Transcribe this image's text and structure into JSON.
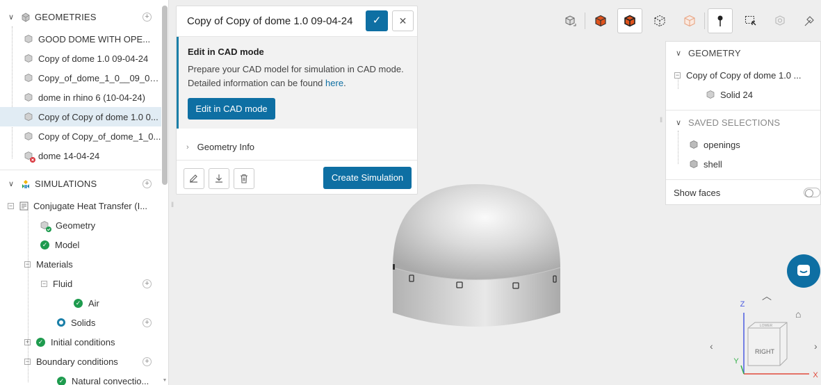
{
  "left_panel": {
    "geometries_header": "GEOMETRIES",
    "geometries": [
      {
        "label": "GOOD DOME WITH OPE..."
      },
      {
        "label": "Copy of dome 1.0 09-04-24"
      },
      {
        "label": "Copy_of_dome_1_0__09_04..."
      },
      {
        "label": "dome in rhino 6 (10-04-24)"
      },
      {
        "label": "Copy of Copy of dome 1.0 0..."
      },
      {
        "label": "Copy of Copy_of_dome_1_0..."
      },
      {
        "label": "dome 14-04-24"
      }
    ],
    "simulations_header": "SIMULATIONS",
    "simulation": {
      "label": "Conjugate Heat Transfer (I...",
      "items": {
        "geometry": "Geometry",
        "model": "Model",
        "materials": "Materials",
        "fluid": "Fluid",
        "air": "Air",
        "solids": "Solids",
        "initial_conditions": "Initial conditions",
        "boundary_conditions": "Boundary conditions",
        "natural_convection": "Natural convectio..."
      }
    }
  },
  "geo_card": {
    "title": "Copy of Copy of dome 1.0  09-04-24",
    "cad_title": "Edit in CAD mode",
    "cad_desc_1": "Prepare your CAD model for simulation in CAD mode.",
    "cad_desc_2": "Detailed information can be found",
    "cad_link": "here",
    "cad_desc_end": ".",
    "cad_button": "Edit in CAD mode",
    "geometry_info": "Geometry Info",
    "create_button": "Create Simulation"
  },
  "right_panel": {
    "geometry_header": "GEOMETRY",
    "geometry_item": "Copy of Copy of dome 1.0 ...",
    "solid_item": "Solid 24",
    "saved_header": "SAVED SELECTIONS",
    "selections": [
      "openings",
      "shell"
    ],
    "show_faces": "Show faces"
  },
  "viewport": {
    "axis_z": "Z",
    "axis_y": "Y",
    "axis_x": "X",
    "cube_face": "RIGHT",
    "cube_top": "LOWER"
  },
  "colors": {
    "accent": "#0e6fa3",
    "success": "#1e9b4e",
    "selected_row": "#e1ecf4"
  }
}
